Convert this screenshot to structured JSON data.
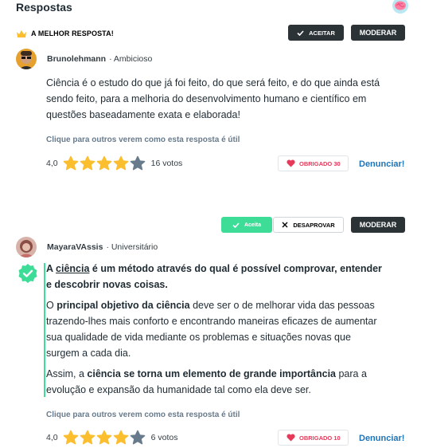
{
  "header": {
    "title": "Respostas",
    "logo_icon": "brain-icon"
  },
  "best_answer": {
    "badge_icon": "crown-icon",
    "label": "A MELHOR RESPOSTA!",
    "accept_label": "ACEITAR",
    "moderate_label": "MODERAR",
    "author": {
      "name": "Brunolehmann",
      "rank": "· Ambicioso"
    },
    "text": "Ciência é o estudo do que já foi feito, do que será feito, e do que ainda está sendo feito, para a melhoria do desenvolvimento humano e científico em questões baseadamente exata e elaborada!",
    "helpful_prompt": "Clique para outros verem como esta resposta é útil",
    "rating": {
      "value": "4,0",
      "stars": 4,
      "max": 5,
      "votes": "16 votos"
    },
    "thanks": {
      "label": "OBRIGADO 30"
    },
    "report_label": "Denunciar!"
  },
  "second_answer": {
    "accepted_label": "Aceita",
    "disapprove_label": "DESAPROVAR",
    "moderate_label": "MODERAR",
    "author": {
      "name": "MayaraVAssis",
      "rank": "· Universitário"
    },
    "p1_a": "A ",
    "p1_b": "ciência",
    "p1_c": " é um método através do qual é possível comprovar, entender e descobrir novas coisas.",
    "p2_a": "O ",
    "p2_b": "principal objetivo da ciência",
    "p2_c": " deve ser o de melhorar vida das pessoas trazendo-lhes mais conforto e encontrando maneiras eficazes de aumentar sua qualidade de vida mediante os problemas e situações novas que surgem a cada dia.",
    "p3_a": "Assim, a ",
    "p3_b": "ciência se torna um elemento de grande importância",
    "p3_c": " para a evolução e expansão da humanidade tal como ela deve ser.",
    "helpful_prompt": "Clique para outros verem como esta resposta é útil",
    "rating": {
      "value": "4,0",
      "stars": 4,
      "max": 5,
      "votes": "6 votos"
    },
    "thanks": {
      "label": "OBRIGADO 10"
    },
    "report_label": "Denunciar!"
  },
  "colors": {
    "accent_green": "#3ddc97",
    "star_gold": "#fbbe2e",
    "star_empty": "#687b8c",
    "link_blue": "#1f73b7",
    "heart_red": "#e8395a",
    "dark_button": "#2b3337"
  }
}
